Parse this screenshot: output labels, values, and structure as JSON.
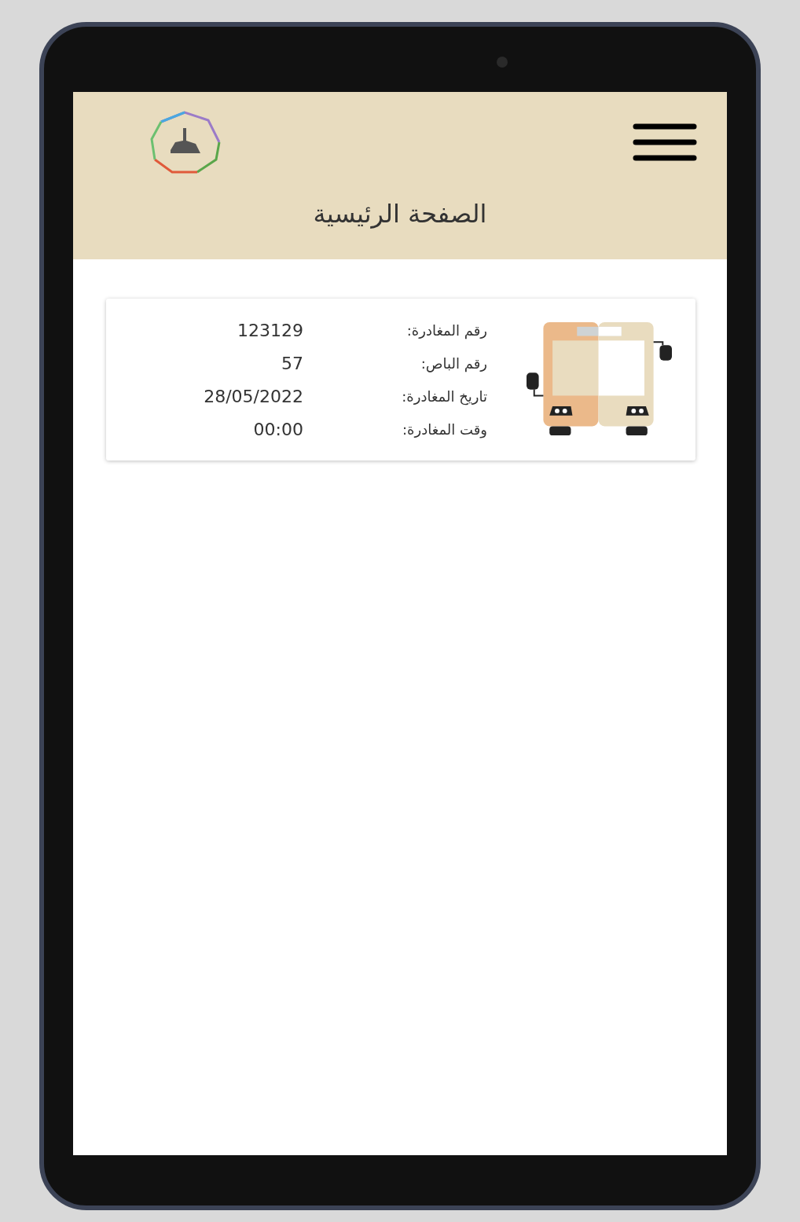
{
  "header": {
    "title": "الصفحة الرئيسية"
  },
  "trip_card": {
    "rows": [
      {
        "label": "رقم المغادرة:",
        "value": "123129"
      },
      {
        "label": "رقم الباص:",
        "value": "57"
      },
      {
        "label": "تاريخ المغادرة:",
        "value": "28/05/2022"
      },
      {
        "label": "وقت المغادرة:",
        "value": "00:00"
      }
    ]
  }
}
